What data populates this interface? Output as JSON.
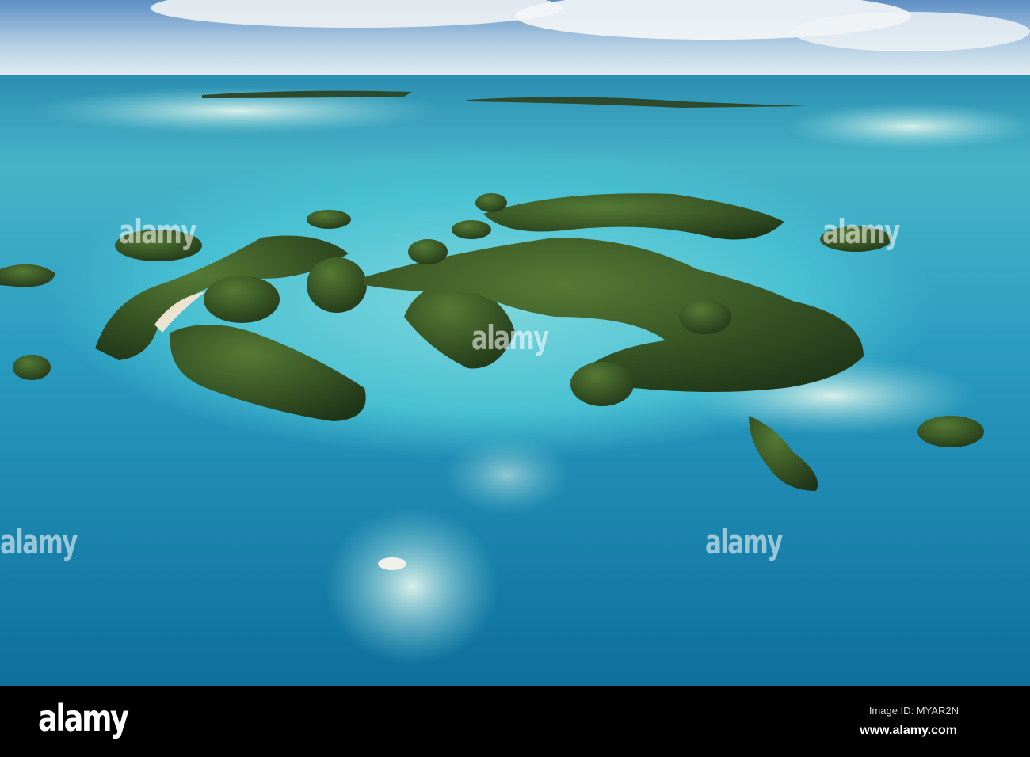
{
  "photo": {
    "subject": "Aerial view of Rock Islands lagoon",
    "colors": {
      "sky": "#9fc3de",
      "deep_ocean": "#1a7fa8",
      "lagoon": "#3fc0d0",
      "shallow": "#9fe0e0",
      "island": "#2f4a22",
      "sand": "#e8e2cc"
    }
  },
  "watermark": {
    "text": "alamy"
  },
  "footer": {
    "logo": "alamy",
    "image_id": "Image ID: MYAR2N",
    "url": "www.alamy.com"
  }
}
